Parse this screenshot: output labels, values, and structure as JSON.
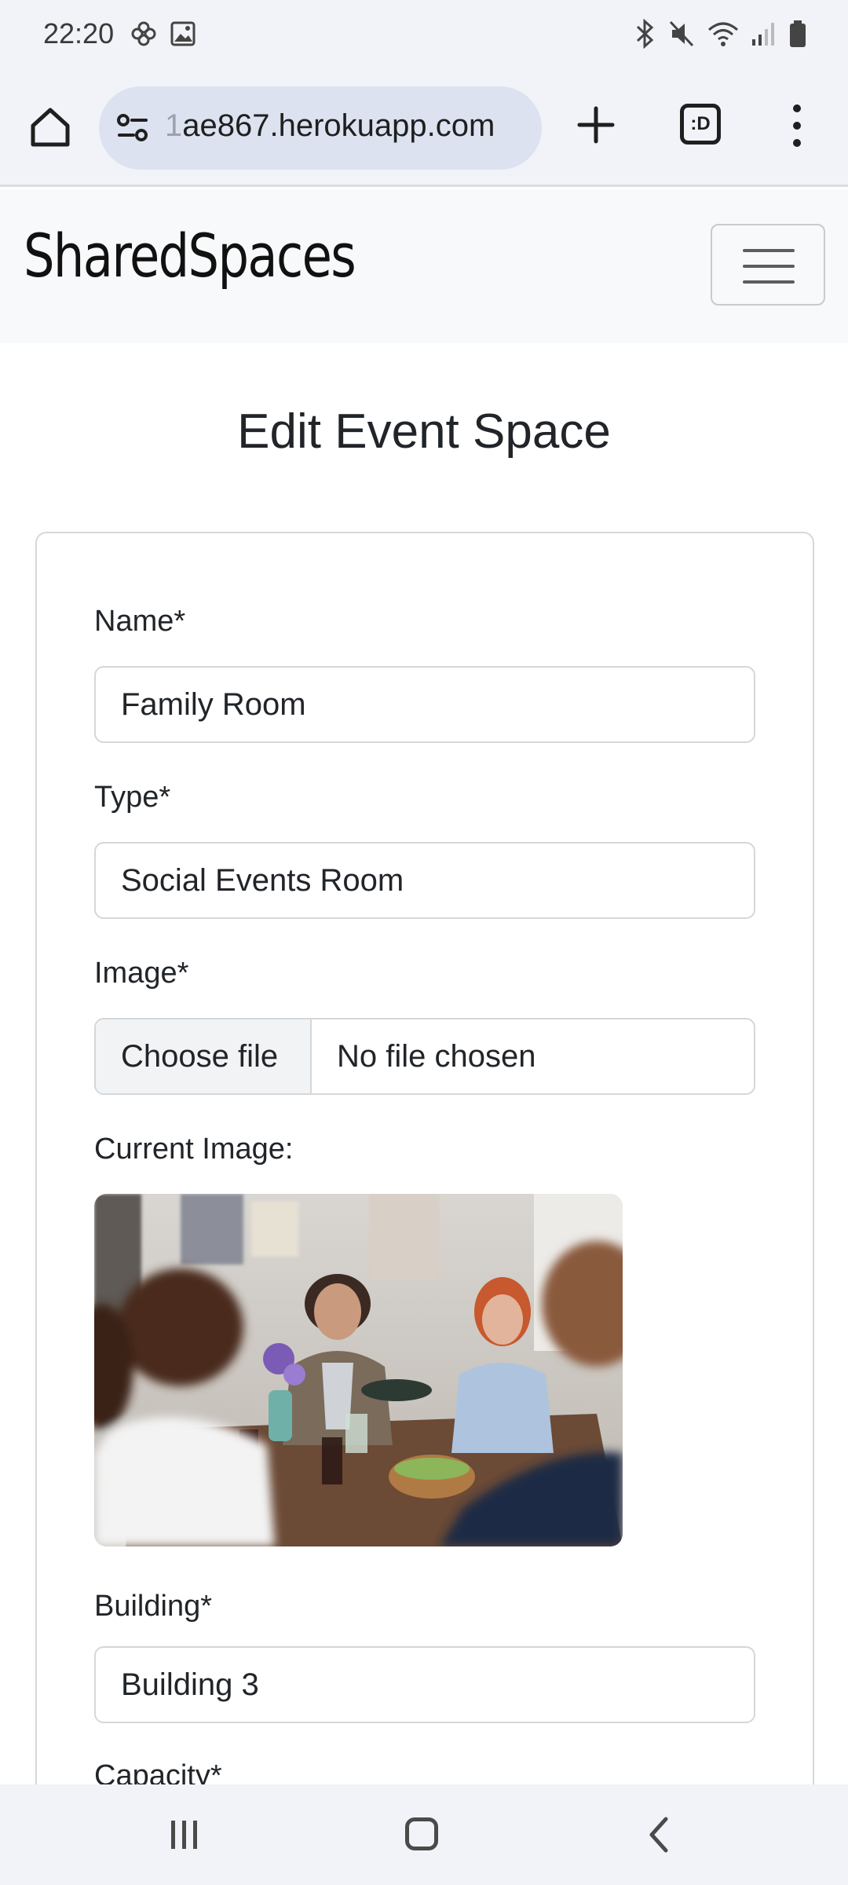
{
  "status_bar": {
    "time": "22:20",
    "left_icons": [
      "flower-icon",
      "gallery-icon"
    ],
    "right_icons": [
      "bluetooth-icon",
      "mute-icon",
      "wifi-icon",
      "signal-icon",
      "battery-icon"
    ]
  },
  "browser": {
    "url_faded_prefix": "1",
    "url_main": "ae867.herokuapp.com",
    "tabs_label": ":D"
  },
  "navbar": {
    "brand": "SharedSpaces"
  },
  "page": {
    "title": "Edit Event Space"
  },
  "form": {
    "name_label": "Name*",
    "name_value": "Family Room",
    "type_label": "Type*",
    "type_value": "Social Events Room",
    "image_label": "Image*",
    "file_button": "Choose file",
    "file_status": "No file chosen",
    "current_image_label": "Current Image:",
    "building_label": "Building*",
    "building_value": "Building 3",
    "capacity_label": "Capacity*"
  },
  "colors": {
    "status_bg": "#f2f3f8",
    "url_pill": "#dde2f0",
    "navbar_bg": "#f8f9fa",
    "text": "#212529",
    "border": "#d4d7da"
  }
}
